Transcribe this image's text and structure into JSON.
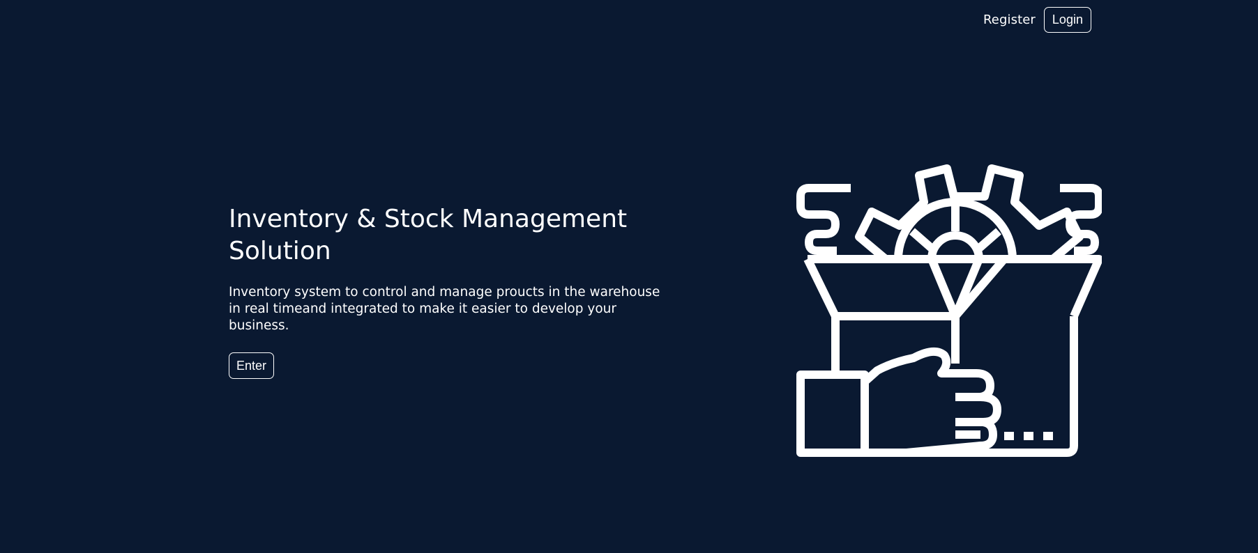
{
  "nav": {
    "register_label": "Register",
    "login_label": "Login"
  },
  "hero": {
    "title_line1": "Inventory & Stock Management",
    "title_line2": "Solution",
    "description": "Inventory system to control and manage proucts in the warehouse in real timeand integrated to make it easier to develop your business.",
    "enter_label": "Enter",
    "illustration_icon": "box-gear-hand-icon"
  },
  "colors": {
    "background": "#0a1931",
    "foreground": "#ffffff"
  }
}
